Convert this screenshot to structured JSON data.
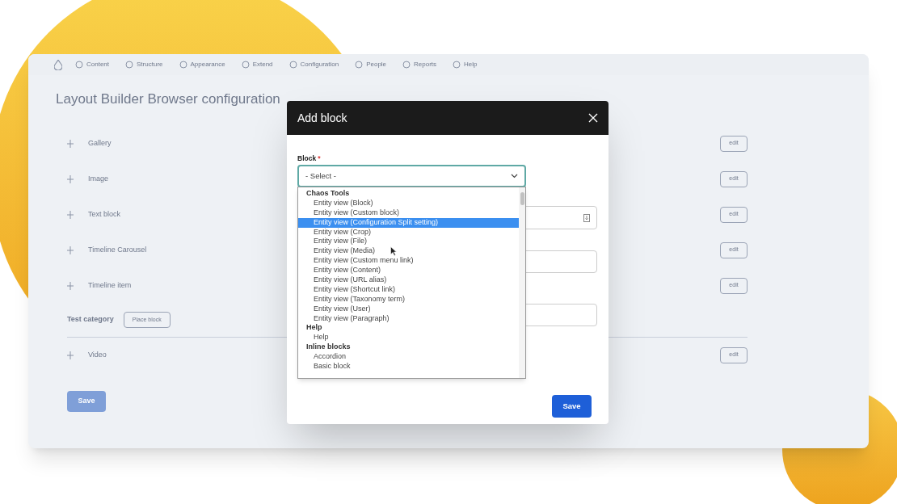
{
  "toolbar": {
    "items": [
      {
        "label": "Content"
      },
      {
        "label": "Structure"
      },
      {
        "label": "Appearance"
      },
      {
        "label": "Extend"
      },
      {
        "label": "Configuration"
      },
      {
        "label": "People"
      },
      {
        "label": "Reports"
      },
      {
        "label": "Help"
      }
    ]
  },
  "page": {
    "title": "Layout Builder Browser configuration",
    "groups": [
      {
        "rows": [
          {
            "label": "Gallery",
            "action": "edit"
          },
          {
            "label": "Image",
            "action": "edit"
          },
          {
            "label": "Text block",
            "action": "edit"
          },
          {
            "label": "Timeline Carousel",
            "action": "edit"
          },
          {
            "label": "Timeline item",
            "action": "edit"
          }
        ]
      },
      {
        "category": "Test category",
        "button": "Place block",
        "rows": [
          {
            "label": "Video",
            "action": "edit"
          }
        ]
      }
    ],
    "save_button": "Save"
  },
  "dialog": {
    "title": "Add block",
    "field": {
      "label": "Block",
      "required_mark": "*",
      "value": "- Select -"
    },
    "options": [
      {
        "kind": "group",
        "label": "Chaos Tools"
      },
      {
        "kind": "option",
        "label": "Entity view (Block)",
        "selected": false
      },
      {
        "kind": "option",
        "label": "Entity view (Custom block)",
        "selected": false
      },
      {
        "kind": "option",
        "label": "Entity view (Configuration Split setting)",
        "selected": true
      },
      {
        "kind": "option",
        "label": "Entity view (Crop)",
        "selected": false
      },
      {
        "kind": "option",
        "label": "Entity view (File)",
        "selected": false
      },
      {
        "kind": "option",
        "label": "Entity view (Media)",
        "selected": false
      },
      {
        "kind": "option",
        "label": "Entity view (Custom menu link)",
        "selected": false
      },
      {
        "kind": "option",
        "label": "Entity view (Content)",
        "selected": false
      },
      {
        "kind": "option",
        "label": "Entity view (URL alias)",
        "selected": false
      },
      {
        "kind": "option",
        "label": "Entity view (Shortcut link)",
        "selected": false
      },
      {
        "kind": "option",
        "label": "Entity view (Taxonomy term)",
        "selected": false
      },
      {
        "kind": "option",
        "label": "Entity view (User)",
        "selected": false
      },
      {
        "kind": "option",
        "label": "Entity view (Paragraph)",
        "selected": false
      },
      {
        "kind": "group",
        "label": "Help"
      },
      {
        "kind": "option",
        "label": "Help",
        "selected": false
      },
      {
        "kind": "group",
        "label": "Inline blocks"
      },
      {
        "kind": "option",
        "label": "Accordion",
        "selected": false
      },
      {
        "kind": "option",
        "label": "Basic block",
        "selected": false
      }
    ],
    "save_button": "Save"
  }
}
